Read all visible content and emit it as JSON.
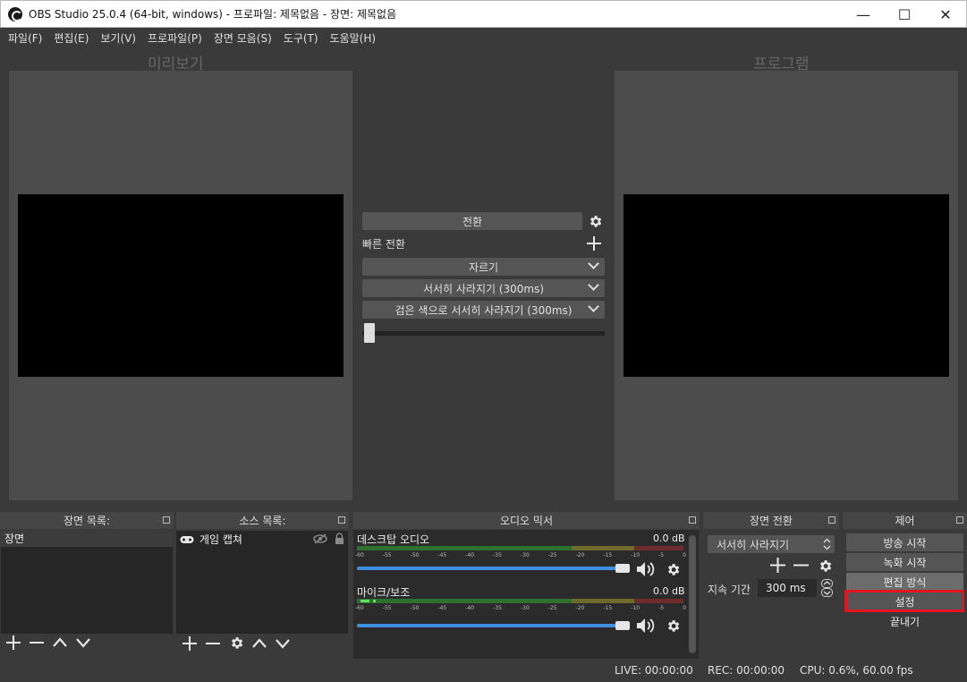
{
  "window": {
    "title": "OBS Studio 25.0.4 (64-bit, windows) - 프로파일: 제목없음 - 장면: 제목없음",
    "minimize": "—",
    "maximize": "☐",
    "close": "✕"
  },
  "menu": [
    "파일(F)",
    "편집(E)",
    "보기(V)",
    "프로파일(P)",
    "장면 모음(S)",
    "도구(T)",
    "도움말(H)"
  ],
  "preview_label": "미리보기",
  "program_label": "프로그램",
  "transition": {
    "button": "전환",
    "quick_label": "빠른 전환",
    "items": [
      "자르기",
      "서서히 사라지기 (300ms)",
      "검은 색으로 서서히 사라지기 (300ms)"
    ],
    "tbar_position": 0
  },
  "docks": {
    "scenes": {
      "title": "장면 목록:",
      "items": [
        "장면"
      ]
    },
    "sources": {
      "title": "소스 목록:",
      "items": [
        "게임 캡쳐"
      ]
    },
    "mixer": {
      "title": "오디오 믹서",
      "channels": [
        {
          "name": "데스크탑 오디오",
          "db": "0.0 dB",
          "volume": 1.0
        },
        {
          "name": "마이크/보조",
          "db": "0.0 dB",
          "volume": 1.0
        }
      ],
      "ticks": [
        "-60",
        "-55",
        "-50",
        "-45",
        "-40",
        "-35",
        "-30",
        "-25",
        "-20",
        "-15",
        "-10",
        "-5",
        "0"
      ]
    },
    "scene_transitions": {
      "title": "장면 전환",
      "selected": "서서히 사라지기",
      "duration_label": "지속 기간",
      "duration_value": "300 ms"
    },
    "controls": {
      "title": "제어",
      "buttons": [
        "방송 시작",
        "녹화 시작",
        "편집 방식",
        "설정",
        "끝내기"
      ]
    }
  },
  "status": {
    "live": "LIVE: 00:00:00",
    "rec": "REC: 00:00:00",
    "cpu": "CPU: 0.6%, 60.00 fps"
  },
  "colors": {
    "highlight": "#e3141e",
    "volume_slider": "#3d8fe0"
  }
}
